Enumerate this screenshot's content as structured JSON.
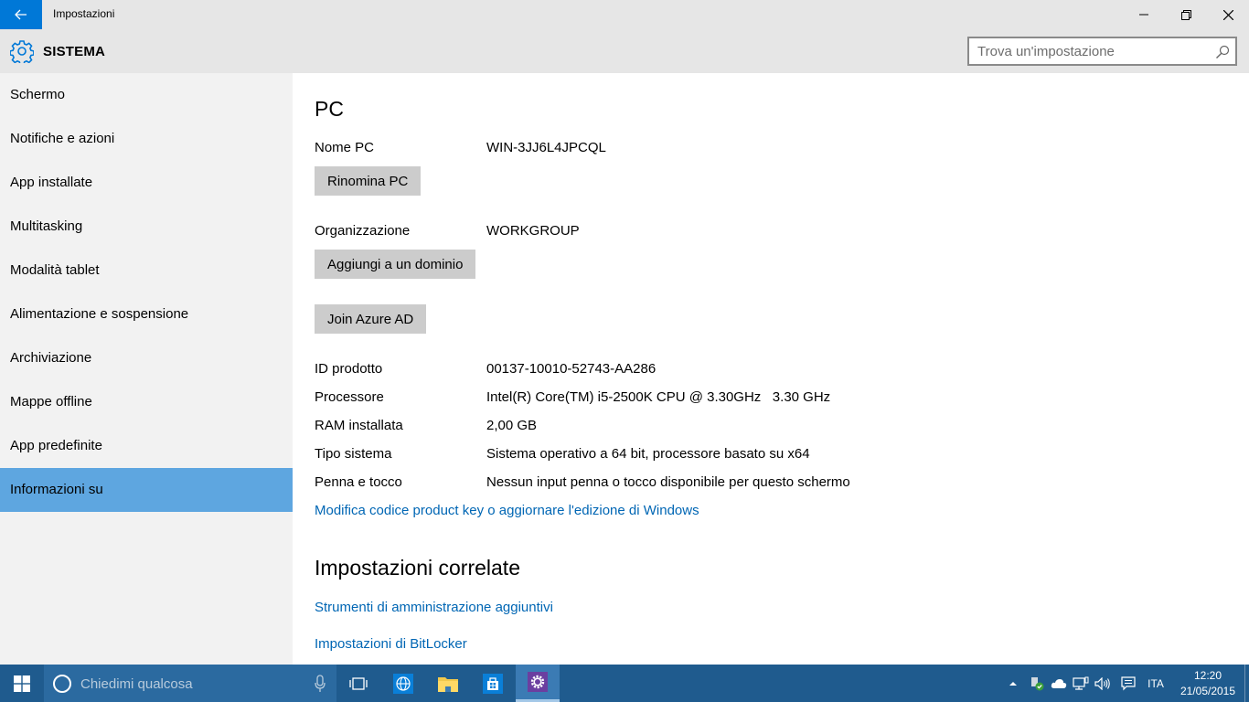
{
  "window": {
    "title": "Impostazioni"
  },
  "header": {
    "section_title": "SISTEMA",
    "search_placeholder": "Trova un'impostazione"
  },
  "sidebar": {
    "items": [
      {
        "label": "Schermo"
      },
      {
        "label": "Notifiche e azioni"
      },
      {
        "label": "App installate"
      },
      {
        "label": "Multitasking"
      },
      {
        "label": "Modalità tablet"
      },
      {
        "label": "Alimentazione e sospensione"
      },
      {
        "label": "Archiviazione"
      },
      {
        "label": "Mappe offline"
      },
      {
        "label": "App predefinite"
      },
      {
        "label": "Informazioni su"
      }
    ],
    "active_index": 9
  },
  "main": {
    "heading": "PC",
    "pc_name": {
      "label": "Nome PC",
      "value": "WIN-3JJ6L4JPCQL"
    },
    "rename_button": "Rinomina PC",
    "organization": {
      "label": "Organizzazione",
      "value": "WORKGROUP"
    },
    "join_domain_button": "Aggiungi a un dominio",
    "join_azure_button": "Join Azure AD",
    "specs": [
      {
        "label": "ID prodotto",
        "value": "00137-10010-52743-AA286"
      },
      {
        "label": "Processore",
        "value": "Intel(R) Core(TM) i5-2500K CPU @ 3.30GHz   3.30 GHz"
      },
      {
        "label": "RAM installata",
        "value": "2,00 GB"
      },
      {
        "label": "Tipo sistema",
        "value": "Sistema operativo a 64 bit, processore basato su x64"
      },
      {
        "label": "Penna e tocco",
        "value": "Nessun input penna o tocco disponibile per questo schermo"
      }
    ],
    "product_key_link": "Modifica codice product key o aggiornare l'edizione di Windows",
    "related_heading": "Impostazioni correlate",
    "related_links": [
      {
        "label": "Strumenti di amministrazione aggiuntivi"
      },
      {
        "label": "Impostazioni di BitLocker"
      }
    ]
  },
  "taskbar": {
    "search_placeholder": "Chiedimi qualcosa",
    "language": "ITA",
    "time": "12:20",
    "date": "21/05/2015"
  },
  "colors": {
    "accent": "#0078d7",
    "sidebar_active": "#5ea6e0",
    "link": "#0066b4",
    "taskbar": "#1f5b8e"
  }
}
